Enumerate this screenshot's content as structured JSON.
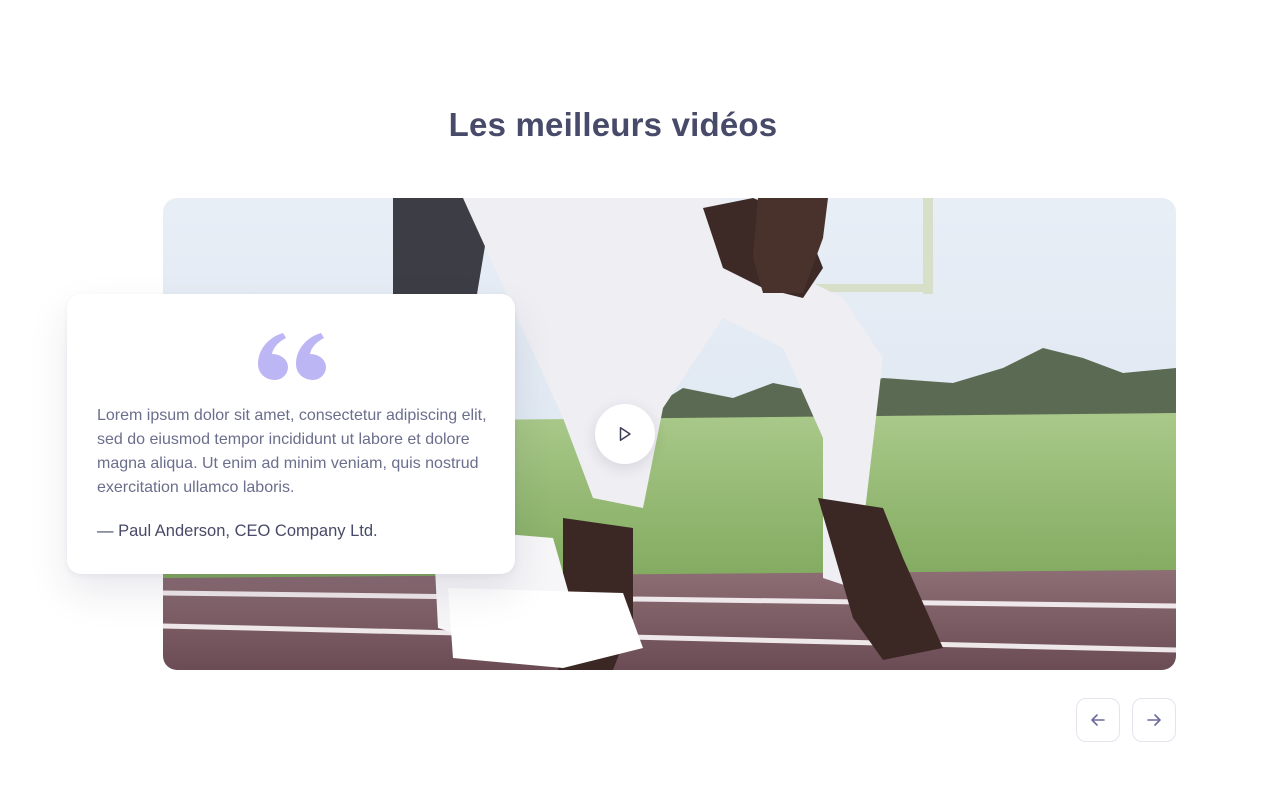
{
  "section": {
    "title": "Les meilleurs vidéos"
  },
  "testimonial": {
    "text": "Lorem ipsum dolor sit amet, consectetur adipiscing elit, sed do eiusmod tempor incididunt ut labore et dolore magna aliqua. Ut enim ad minim veniam, quis nostrud exercitation ullamco laboris.",
    "author": "— Paul Anderson, CEO Company Ltd.",
    "quote_icon": "quote-open-icon"
  },
  "video": {
    "play_icon": "play-icon"
  },
  "navigation": {
    "prev_icon": "arrow-left-icon",
    "next_icon": "arrow-right-icon"
  },
  "colors": {
    "title": "#474a68",
    "body_text": "#6b6e8c",
    "quote_accent": "#bdb6f4",
    "nav_icon": "#6d6b9c"
  }
}
